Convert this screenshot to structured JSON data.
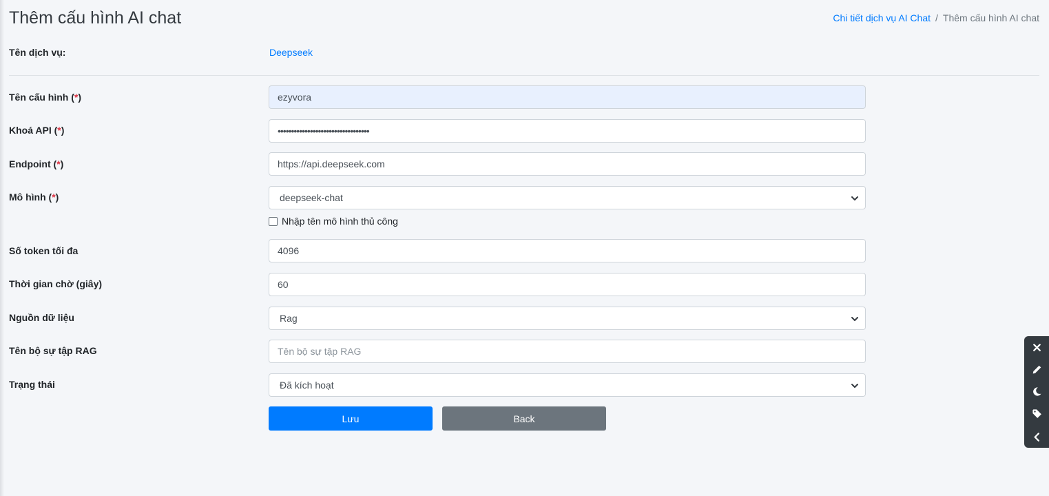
{
  "page": {
    "title": "Thêm cấu hình AI chat"
  },
  "breadcrumb": {
    "parent": "Chi tiết dịch vụ AI Chat",
    "separator": "/",
    "current": "Thêm cấu hình AI chat"
  },
  "service": {
    "label": "Tên dịch vụ:",
    "value": "Deepseek"
  },
  "form": {
    "required_mark": "*",
    "config_name": {
      "label": "Tên cấu hình",
      "value": "ezyvora"
    },
    "api_key": {
      "label": "Khoá API",
      "value": "••••••••••••••••••••••••••••••••••"
    },
    "endpoint": {
      "label": "Endpoint",
      "value": "https://api.deepseek.com"
    },
    "model": {
      "label": "Mô hình",
      "selected": "deepseek-chat",
      "manual_checkbox_label": "Nhập tên mô hình thủ công",
      "manual_checked": false
    },
    "max_tokens": {
      "label": "Số token tối đa",
      "value": "4096"
    },
    "timeout": {
      "label": "Thời gian chờ (giây)",
      "value": "60"
    },
    "data_source": {
      "label": "Nguồn dữ liệu",
      "selected": "Rag"
    },
    "rag_collection": {
      "label": "Tên bộ sự tập RAG",
      "placeholder": "Tên bộ sự tập RAG",
      "value": ""
    },
    "status": {
      "label": "Trạng thái",
      "selected": "Đã kích hoạt"
    }
  },
  "buttons": {
    "save": "Lưu",
    "back": "Back"
  },
  "toolbar": {
    "icons": [
      "close-icon",
      "pencil-icon",
      "moon-icon",
      "tag-icon",
      "chevron-left-icon"
    ]
  },
  "colors": {
    "primary": "#007bff",
    "secondary": "#6c757d",
    "required": "#dc3545",
    "background": "#f4f6f9",
    "toolbar": "#343a40",
    "autofill": "#e8f0fe"
  }
}
